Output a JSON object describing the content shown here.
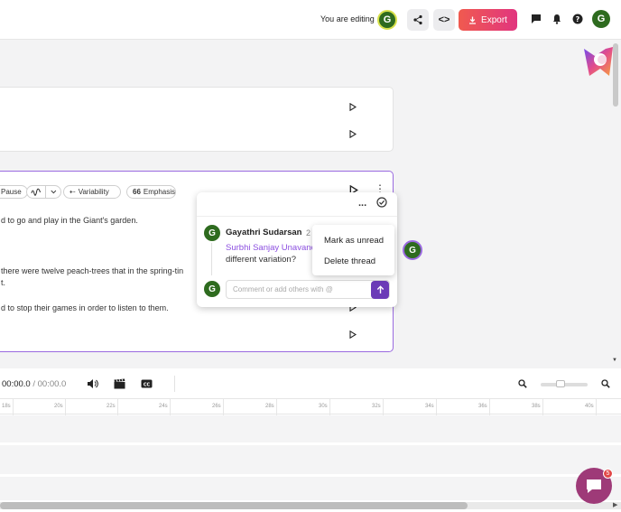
{
  "header": {
    "editing_label": "You are editing",
    "editor_avatar": "G",
    "share_icon": "share-icon",
    "embed_label": "<>",
    "export_label": "Export",
    "user_avatar": "G",
    "accent_gradient": [
      "#f05a4f",
      "#e1357f"
    ]
  },
  "script_card2": {
    "chips": [
      "Pause",
      "Variability",
      "Emphasis"
    ],
    "lines": [
      "d to go and play in the Giant's garden.",
      "there were twelve peach-trees that in the spring-tin",
      "t.",
      "d to stop their games in order to listen to them."
    ]
  },
  "comment_thread": {
    "author_avatar": "G",
    "author_name": "Gayathri Sudarsan",
    "author_suffix": "2",
    "mention": "Surbhi Sanjay Unavane",
    "comment_text": "different variation?",
    "reply_avatar": "G",
    "reply_placeholder": "Comment or add others with @",
    "more_label": "...",
    "menu": [
      "Mark as unread",
      "Delete thread"
    ]
  },
  "floating_avatar": "G",
  "timeline": {
    "current_time": "00:00.0",
    "separator": " / ",
    "total_time": "00:00.0",
    "ruler_labels": [
      "18s",
      "20s",
      "22s",
      "24s",
      "26s",
      "28s",
      "30s",
      "32s",
      "34s",
      "36s",
      "38s",
      "40s"
    ]
  },
  "chat": {
    "badge_count": "5"
  },
  "colors": {
    "selected_border": "#9a6ae0",
    "mention": "#8c4fe0",
    "send_button": "#6b3bb7",
    "avatar_green": "#2e6b1f",
    "chat_fab": "#9e3a78"
  }
}
